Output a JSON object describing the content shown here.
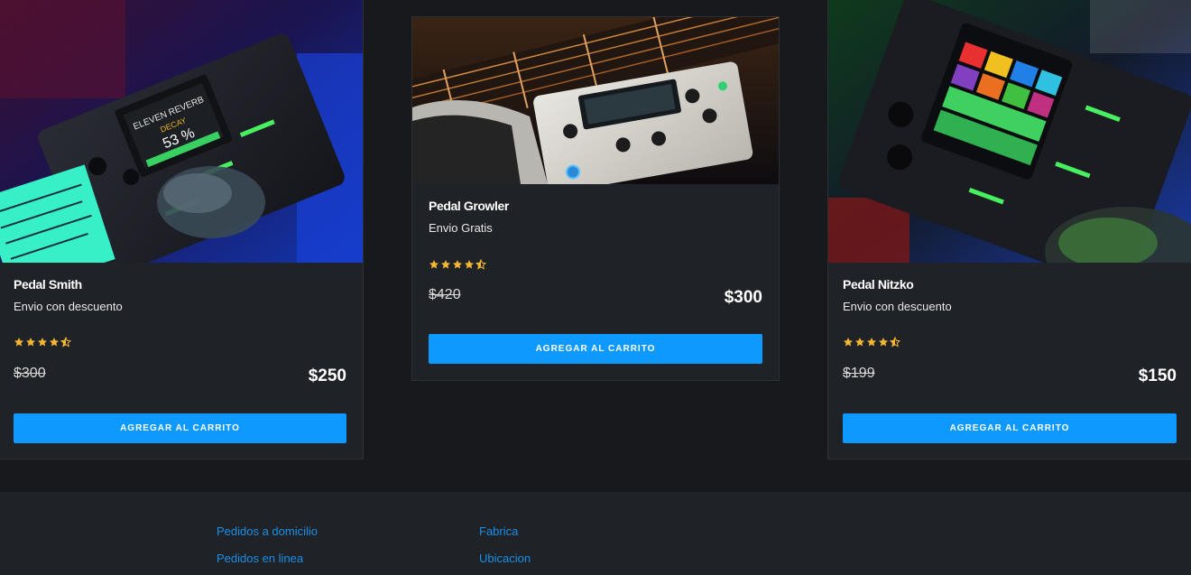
{
  "products": [
    {
      "name": "Pedal Smith",
      "shipping": "Envio con descuento",
      "rating": 4.5,
      "old_price": "$300",
      "price": "$250",
      "button_label": "AGREGAR AL CARRITO",
      "photo_icon": "pedal-photo"
    },
    {
      "name": "Pedal Growler",
      "shipping": "Envio Gratis",
      "rating": 4.5,
      "old_price": "$420",
      "price": "$300",
      "button_label": "AGREGAR AL CARRITO",
      "photo_icon": "pedal-photo"
    },
    {
      "name": "Pedal Nitzko",
      "shipping": "Envio con descuento",
      "rating": 4.5,
      "old_price": "$199",
      "price": "$150",
      "button_label": "AGREGAR AL CARRITO",
      "photo_icon": "pedal-photo"
    }
  ],
  "footer": {
    "links_col1": [
      "Pedidos a domicilio",
      "Pedidos en linea"
    ],
    "links_col2": [
      "Fabrica",
      "Ubicacion"
    ]
  },
  "colors": {
    "accent": "#0d99ff",
    "star": "#f5b731",
    "link": "#1a8fe8",
    "card_bg": "#1f2226",
    "page_bg": "#17191c"
  }
}
